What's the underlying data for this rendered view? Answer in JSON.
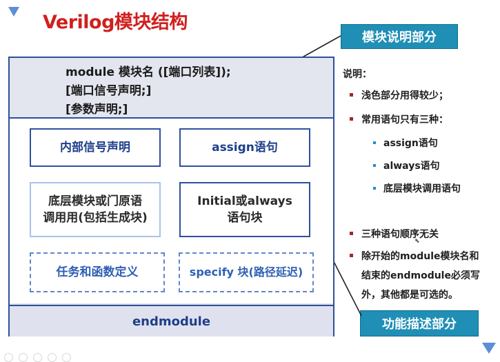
{
  "title": "Verilog模块结构",
  "ghost": "",
  "callouts": {
    "module_desc": "模块说明部分",
    "func_desc": "功能描述部分"
  },
  "module_area": {
    "line1": "module 模块名 ([端口列表]);",
    "line2": "[端口信号声明;]",
    "line3": "[参数声明;]"
  },
  "blocks": {
    "internal_signal": "内部信号声明",
    "assign": "assign语句",
    "lowlevel_line1": "底层模块或门原语",
    "lowlevel_line2": "调用用(包括生成块)",
    "initial_line1": "Initial或always",
    "initial_line2": "语句块",
    "task_func": "任务和函数定义",
    "specify": "specify 块(路径延迟)"
  },
  "endmodule": "endmodule",
  "notes": {
    "head": "说明：",
    "n1": "浅色部分用得较少；",
    "n2": "常用语句只有三种：",
    "sub1": "assign语句",
    "sub2": "always语句",
    "sub3": "底层模块调用语句",
    "n3": "三种语句顺序无关",
    "n4_line1": "除开始的module模块名和",
    "n4_line2": "结束的endmodule必须写",
    "n4_line3": "外，其他都是可选的。"
  },
  "colors": {
    "title": "#d0201f",
    "callout_bg": "#1f8fb6",
    "border": "#2d4f9c",
    "module_bg": "#e3e5ef",
    "text_blue": "#1e3e8a",
    "dashed_text": "#2f5fb3",
    "bullet_main": "#9b2b2b",
    "bullet_sub": "#1e8ecb"
  },
  "icons": {
    "top_left": "triangle-marker-icon",
    "bottom_right": "triangle-marker-icon"
  }
}
